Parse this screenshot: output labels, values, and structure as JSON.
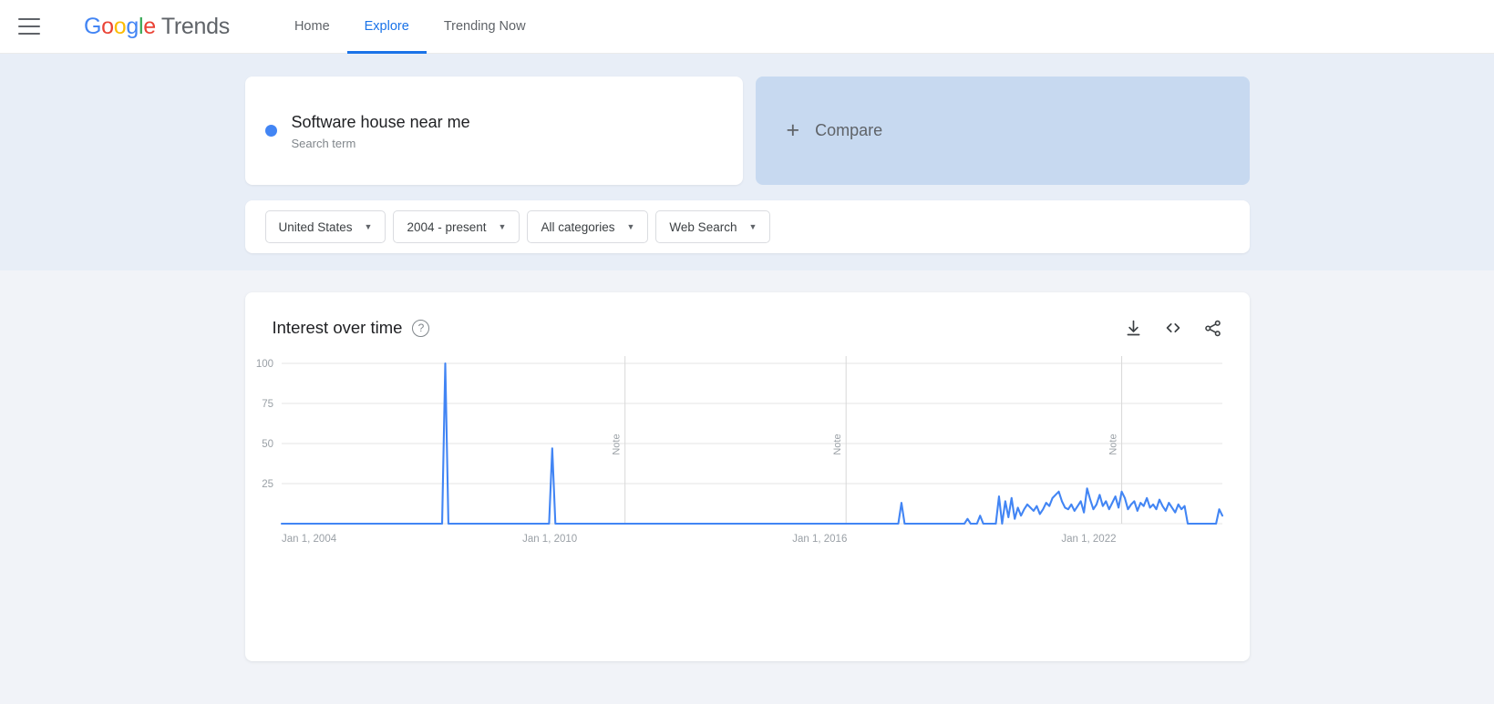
{
  "header": {
    "menu_icon": "hamburger-menu-icon",
    "brand_google": "Google",
    "brand_product": "Trends",
    "nav": [
      {
        "label": "Home",
        "active": false
      },
      {
        "label": "Explore",
        "active": true
      },
      {
        "label": "Trending Now",
        "active": false
      }
    ]
  },
  "search_card": {
    "term": "Software house near me",
    "type_label": "Search term",
    "dot_color": "#4285f4"
  },
  "compare_card": {
    "label": "Compare",
    "plus_icon": "plus-icon",
    "background": "#c7d9f0"
  },
  "filters": [
    {
      "label": "United States",
      "name": "location"
    },
    {
      "label": "2004 - present",
      "name": "time-range"
    },
    {
      "label": "All categories",
      "name": "category"
    },
    {
      "label": "Web Search",
      "name": "search-type"
    }
  ],
  "chart_panel": {
    "title": "Interest over time",
    "help_icon": "help-circle-icon",
    "tools": [
      {
        "name": "download-icon",
        "label": "Download"
      },
      {
        "name": "embed-code-icon",
        "label": "Embed"
      },
      {
        "name": "share-icon",
        "label": "Share"
      }
    ]
  },
  "chart_data": {
    "type": "line",
    "title": "Interest over time",
    "xlabel": "",
    "ylabel": "",
    "ylim": [
      0,
      100
    ],
    "y_ticks": [
      100,
      75,
      50,
      25
    ],
    "x_tick_labels": [
      "Jan 1, 2004",
      "Jan 1, 2010",
      "Jan 1, 2016",
      "Jan 1, 2022"
    ],
    "x_tick_positions": [
      0,
      0.285,
      0.572,
      0.858
    ],
    "grid": true,
    "legend_position": "none",
    "line_color": "#4285f4",
    "annotations": [
      {
        "label": "Note",
        "x": 0.365
      },
      {
        "label": "Note",
        "x": 0.6
      },
      {
        "label": "Note",
        "x": 0.893
      }
    ],
    "series": [
      {
        "name": "Software house near me",
        "color": "#4285f4",
        "values": [
          0,
          0,
          0,
          0,
          0,
          0,
          0,
          0,
          0,
          0,
          0,
          0,
          0,
          0,
          0,
          0,
          0,
          0,
          0,
          0,
          0,
          0,
          0,
          0,
          0,
          0,
          0,
          0,
          0,
          0,
          0,
          0,
          0,
          0,
          0,
          0,
          0,
          0,
          0,
          0,
          0,
          0,
          0,
          0,
          0,
          0,
          0,
          0,
          0,
          0,
          0,
          0,
          100,
          0,
          0,
          0,
          0,
          0,
          0,
          0,
          0,
          0,
          0,
          0,
          0,
          0,
          0,
          0,
          0,
          0,
          0,
          0,
          0,
          0,
          0,
          0,
          0,
          0,
          0,
          0,
          0,
          0,
          0,
          0,
          0,
          0,
          47,
          0,
          0,
          0,
          0,
          0,
          0,
          0,
          0,
          0,
          0,
          0,
          0,
          0,
          0,
          0,
          0,
          0,
          0,
          0,
          0,
          0,
          0,
          0,
          0,
          0,
          0,
          0,
          0,
          0,
          0,
          0,
          0,
          0,
          0,
          0,
          0,
          0,
          0,
          0,
          0,
          0,
          0,
          0,
          0,
          0,
          0,
          0,
          0,
          0,
          0,
          0,
          0,
          0,
          0,
          0,
          0,
          0,
          0,
          0,
          0,
          0,
          0,
          0,
          0,
          0,
          0,
          0,
          0,
          0,
          0,
          0,
          0,
          0,
          0,
          0,
          0,
          0,
          0,
          0,
          0,
          0,
          0,
          0,
          0,
          0,
          0,
          0,
          0,
          0,
          0,
          0,
          0,
          0,
          0,
          0,
          0,
          0,
          0,
          0,
          0,
          0,
          0,
          0,
          0,
          0,
          0,
          0,
          0,
          0,
          0,
          13,
          0,
          0,
          0,
          0,
          0,
          0,
          0,
          0,
          0,
          0,
          0,
          0,
          0,
          0,
          0,
          0,
          0,
          0,
          0,
          0,
          3,
          0,
          0,
          0,
          5,
          0,
          0,
          0,
          0,
          0,
          17,
          0,
          14,
          4,
          16,
          3,
          10,
          5,
          9,
          12,
          10,
          8,
          11,
          6,
          9,
          13,
          11,
          16,
          18,
          20,
          14,
          10,
          9,
          12,
          8,
          11,
          14,
          7,
          22,
          15,
          9,
          12,
          18,
          11,
          14,
          9,
          13,
          17,
          10,
          20,
          16,
          9,
          12,
          14,
          8,
          13,
          11,
          16,
          10,
          12,
          9,
          15,
          11,
          8,
          13,
          10,
          7,
          12,
          9,
          11,
          0,
          0,
          0,
          0,
          0,
          0,
          0,
          0,
          0,
          0,
          9,
          5
        ]
      }
    ]
  }
}
